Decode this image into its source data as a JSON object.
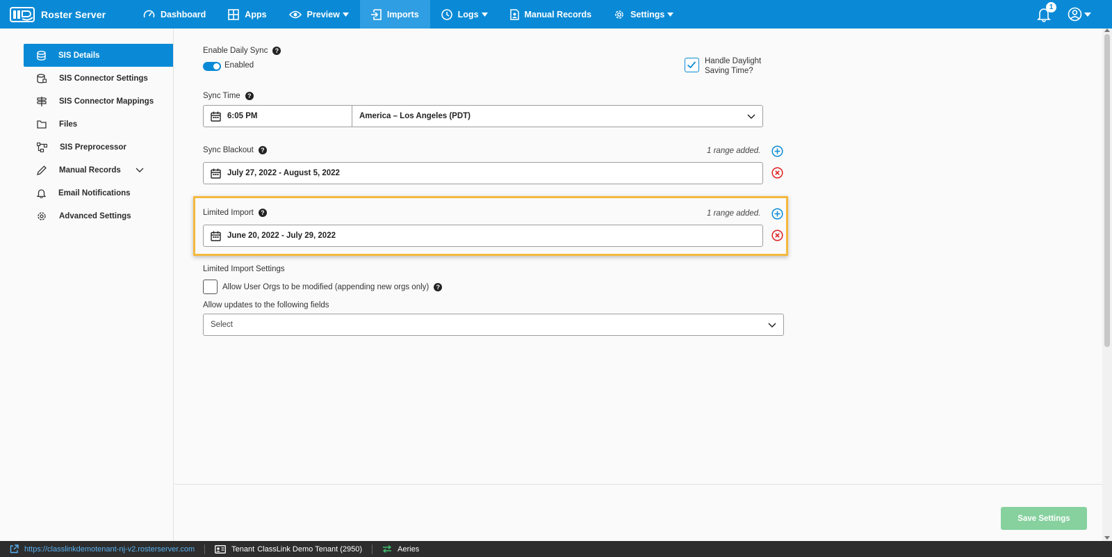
{
  "app": {
    "name": "Roster Server"
  },
  "nav": {
    "items": [
      {
        "label": "Dashboard",
        "icon": "gauge-icon"
      },
      {
        "label": "Apps",
        "icon": "grid-icon"
      },
      {
        "label": "Preview",
        "icon": "eye-icon",
        "dropdown": true
      },
      {
        "label": "Imports",
        "icon": "import-icon",
        "active": true
      },
      {
        "label": "Logs",
        "icon": "clock-icon",
        "dropdown": true
      },
      {
        "label": "Manual Records",
        "icon": "file-user-icon"
      },
      {
        "label": "Settings",
        "icon": "gear-icon",
        "dropdown": true
      }
    ],
    "notification_count": "1"
  },
  "sidebar": {
    "items": [
      {
        "label": "SIS Details",
        "icon": "database-icon",
        "active": true
      },
      {
        "label": "SIS Connector Settings",
        "icon": "database-cog-icon"
      },
      {
        "label": "SIS Connector Mappings",
        "icon": "signpost-icon"
      },
      {
        "label": "Files",
        "icon": "folder-icon"
      },
      {
        "label": "SIS Preprocessor",
        "icon": "flow-icon"
      },
      {
        "label": "Manual Records",
        "icon": "pencil-icon",
        "expandable": true
      },
      {
        "label": "Email Notifications",
        "icon": "bell-icon"
      },
      {
        "label": "Advanced Settings",
        "icon": "gear-icon"
      }
    ]
  },
  "form": {
    "daily_sync": {
      "label": "Enable Daily Sync",
      "state": "Enabled",
      "on": true
    },
    "daylight": {
      "label_line1": "Handle Daylight",
      "label_line2": "Saving Time?",
      "checked": true
    },
    "sync_time": {
      "label": "Sync Time",
      "time": "6:05 PM",
      "timezone": "America – Los Angeles (PDT)"
    },
    "sync_blackout": {
      "label": "Sync Blackout",
      "note": "1 range added.",
      "range": "July 27, 2022 - August 5, 2022"
    },
    "limited_import": {
      "label": "Limited Import",
      "note": "1 range added.",
      "range": "June 20, 2022 - July 29, 2022"
    },
    "limited_import_settings": {
      "label": "Limited Import Settings",
      "allow_orgs": {
        "label": "Allow User Orgs to be modified (appending new orgs only)",
        "checked": false
      },
      "fields_label": "Allow updates to the following fields",
      "fields_placeholder": "Select"
    }
  },
  "actions": {
    "save_label": "Save Settings"
  },
  "status": {
    "url": "https://classlinkdemotenant-nj-v2.rosterserver.com",
    "tenant_prefix": "Tenant",
    "tenant": "ClassLink Demo Tenant (2950)",
    "sis": "Aeries"
  },
  "colors": {
    "primary": "#0a8ad6",
    "save": "#86d19e",
    "danger": "#e02020",
    "highlight": "#f5b93f"
  }
}
